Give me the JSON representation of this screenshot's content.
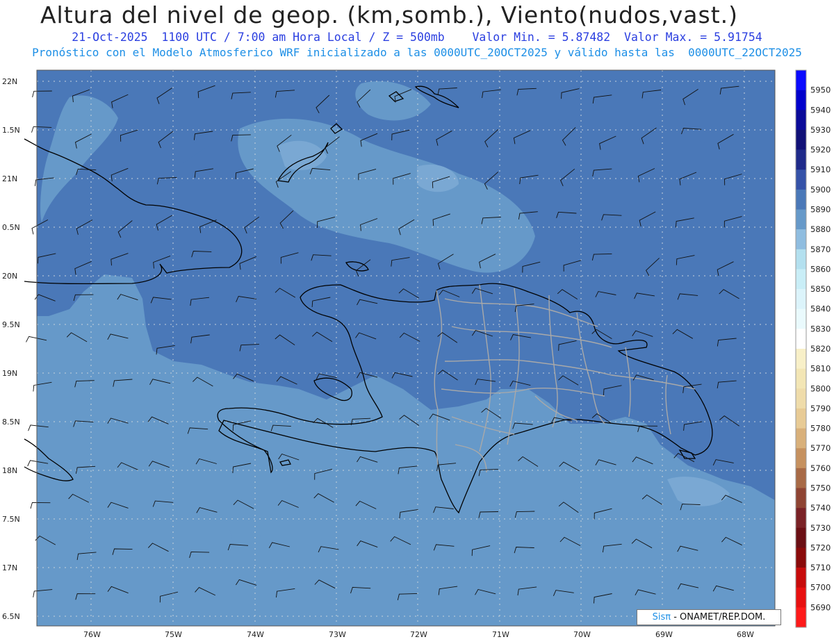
{
  "header": {
    "title": "Altura del nivel de geop. (km,somb.), Viento(nudos,vast.)",
    "subtitle1": "21-Oct-2025  1100 UTC / 7:00 am Hora Local / Z = 500mb    Valor Min. = 5.87482  Valor Max. = 5.91754",
    "subtitle2": "Pronóstico con el Modelo Atmosferico WRF inicializado a las 0000UTC_20OCT2025 y válido hasta las  0000UTC_22OCT2025"
  },
  "axes": {
    "lat_labels": [
      "22N",
      "1.5N",
      "21N",
      "0.5N",
      "20N",
      "9.5N",
      "19N",
      "8.5N",
      "18N",
      "7.5N",
      "17N",
      "6.5N"
    ],
    "lon_labels": [
      "76W",
      "75W",
      "74W",
      "73W",
      "72W",
      "71W",
      "70W",
      "69W",
      "68W"
    ]
  },
  "colorbar": {
    "levels": [
      5950,
      5940,
      5930,
      5920,
      5910,
      5900,
      5890,
      5880,
      5870,
      5860,
      5850,
      5840,
      5830,
      5820,
      5810,
      5800,
      5790,
      5780,
      5770,
      5760,
      5750,
      5740,
      5730,
      5720,
      5710,
      5700,
      5690
    ],
    "colors": [
      "#0a0aff",
      "#0000cc",
      "#0a0a99",
      "#111177",
      "#1f2a8a",
      "#3552a8",
      "#4a78b8",
      "#6699c9",
      "#8fbde0",
      "#b3e0ef",
      "#c9eef7",
      "#dcf4fb",
      "#eafafd",
      "#ffffff",
      "#f8f0c8",
      "#f3e6b5",
      "#efdcaa",
      "#e8cb95",
      "#d9b07a",
      "#c6915f",
      "#a86a46",
      "#8f4433",
      "#7a2226",
      "#6b0f14",
      "#8a0a0a",
      "#c70b0b",
      "#e81010",
      "#ff1a1a"
    ]
  },
  "colors": {
    "field_low": "#6699c9",
    "field_high": "#4a78b8",
    "field_lighter": "#7aa8d3",
    "coast": "#000000",
    "provinces": "#a9a9a9"
  },
  "credit": {
    "brand": "Sisπ",
    "text": " - ONAMET/REP.DOM."
  }
}
